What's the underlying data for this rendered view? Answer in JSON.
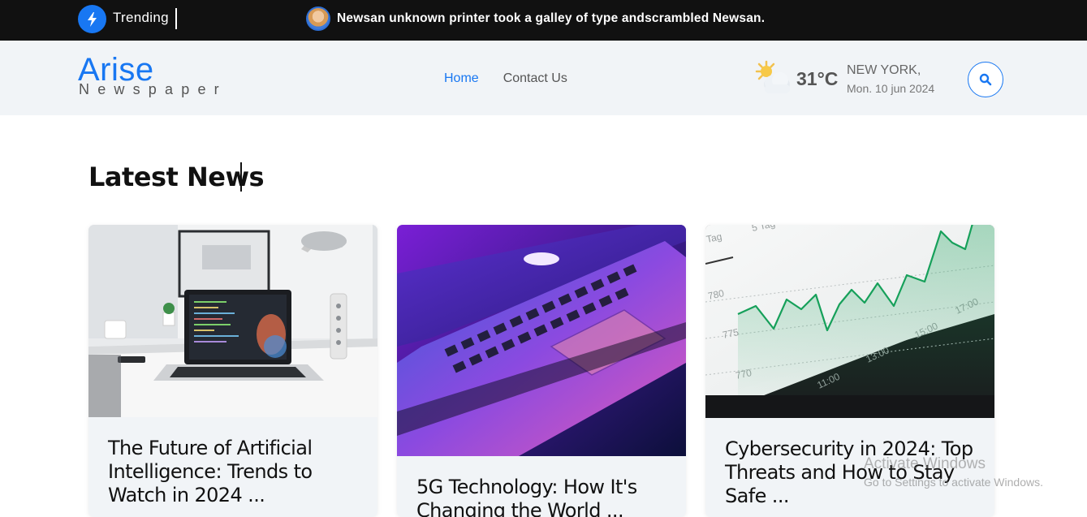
{
  "topbar": {
    "trending_label": "Trending",
    "ticker_text": "Newsan unknown printer took a galley of type andscrambled Newsan."
  },
  "header": {
    "logo_main": "Arise",
    "logo_sub": "Newspaper",
    "nav": [
      {
        "label": "Home",
        "active": true
      },
      {
        "label": "Contact Us",
        "active": false
      }
    ],
    "weather": {
      "temperature": "31°C",
      "city": "NEW YORK,",
      "date": "Mon. 10 jun 2024"
    }
  },
  "main": {
    "section_title": "Latest News",
    "cards": [
      {
        "title": "The Future of Artificial Intelligence: Trends to Watch in 2024 ...",
        "image": "laptop-desk-photo"
      },
      {
        "title": "5G Technology: How It's Changing the World ...",
        "image": "neon-laptop-photo"
      },
      {
        "title": "Cybersecurity in 2024: Top Threats and How to Stay Safe ...",
        "image": "stock-chart-photo"
      }
    ]
  },
  "os_overlay": {
    "line1": "Activate Windows",
    "line2": "Go to Settings to activate Windows."
  },
  "colors": {
    "accent": "#1877f2",
    "topbar_bg": "#111111",
    "header_bg": "#f1f4f7"
  }
}
